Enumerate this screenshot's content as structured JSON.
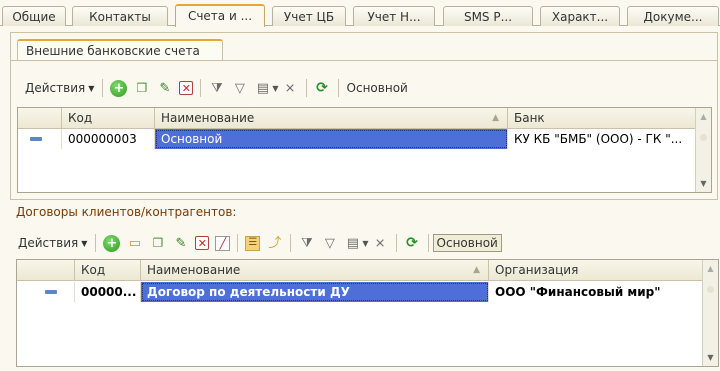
{
  "tabs": [
    {
      "label": "Общие"
    },
    {
      "label": "Контакты"
    },
    {
      "label": "Счета и ..."
    },
    {
      "label": "Учет ЦБ"
    },
    {
      "label": "Учет Н..."
    },
    {
      "label": "SMS Р..."
    },
    {
      "label": "Характ..."
    },
    {
      "label": "Докуме..."
    }
  ],
  "bank_accounts": {
    "subtab_label": "Внешние банковские счета",
    "toolbar": {
      "actions_label": "Действия",
      "main_label": "Основной"
    },
    "columns": [
      "Код",
      "Наименование",
      "Банк"
    ],
    "rows": [
      {
        "code": "000000003",
        "name": "Основной",
        "bank": "КУ КБ \"БМБ\" (ООО) - ГК \"..."
      }
    ]
  },
  "contracts": {
    "title": "Договоры клиентов/контрагентов:",
    "toolbar": {
      "actions_label": "Действия",
      "main_label": "Основной"
    },
    "columns": [
      "Код",
      "Наименование",
      "Организация"
    ],
    "rows": [
      {
        "code": "00000...",
        "name": "Договор по деятельности ДУ",
        "org": "ООО \"Финансовый мир\""
      }
    ]
  },
  "icons": {
    "add": "add-icon",
    "copy": "copy-icon",
    "edit": "edit-icon",
    "delete": "delete-icon",
    "filter": "filter-icon",
    "refresh": "refresh-icon"
  },
  "colors": {
    "selection": "#4f6fd8",
    "active_tab_accent": "#e8a637",
    "section_title": "#7a3b00"
  }
}
